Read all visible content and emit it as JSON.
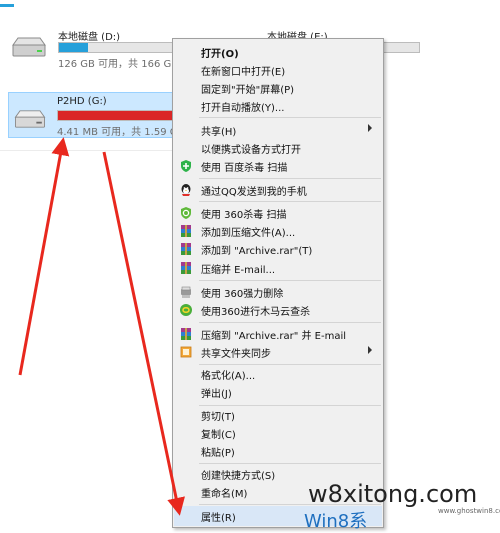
{
  "drives": [
    {
      "name": "本地磁盘 (D:)",
      "info": "126 GB 可用，共 166 GB",
      "fill_fraction": 0.24,
      "bar_color": "#26a0da"
    },
    {
      "name": "本地磁盘 (E:)",
      "info": "",
      "fill_fraction": 0.0,
      "bar_color": "#26a0da"
    },
    {
      "name": "P2HD (G:)",
      "info": "4.41 MB 可用，共 1.59 G",
      "fill_fraction": 0.99,
      "bar_color": "#da2626"
    }
  ],
  "menu": {
    "items": [
      {
        "label": "打开(O)"
      },
      {
        "label": "在新窗口中打开(E)"
      },
      {
        "label": "固定到\"开始\"屏幕(P)"
      },
      {
        "label": "打开自动播放(Y)..."
      },
      {
        "label": "共享(H)"
      },
      {
        "label": "以便携式设备方式打开"
      },
      {
        "label": "使用 百度杀毒 扫描"
      },
      {
        "label": "通过QQ发送到我的手机"
      },
      {
        "label": "使用 360杀毒 扫描"
      },
      {
        "label": "添加到压缩文件(A)..."
      },
      {
        "label": "添加到 \"Archive.rar\"(T)"
      },
      {
        "label": "压缩并 E-mail..."
      },
      {
        "label": "使用 360强力删除"
      },
      {
        "label": "使用360进行木马云查杀"
      },
      {
        "label": "压缩到 \"Archive.rar\" 并 E-mail"
      },
      {
        "label": "共享文件夹同步"
      },
      {
        "label": "格式化(A)..."
      },
      {
        "label": "弹出(J)"
      },
      {
        "label": "剪切(T)"
      },
      {
        "label": "复制(C)"
      },
      {
        "label": "粘贴(P)"
      },
      {
        "label": "创建快捷方式(S)"
      },
      {
        "label": "重命名(M)"
      },
      {
        "label": "属性(R)"
      }
    ]
  },
  "watermark": {
    "main": "w8xitong.com",
    "win": "Win8系",
    "url": "www.ghostwin8.com"
  },
  "colors": {
    "accent": "#26a0da",
    "danger": "#da2626",
    "selection": "#cce8ff",
    "arrow": "#e8281e"
  }
}
